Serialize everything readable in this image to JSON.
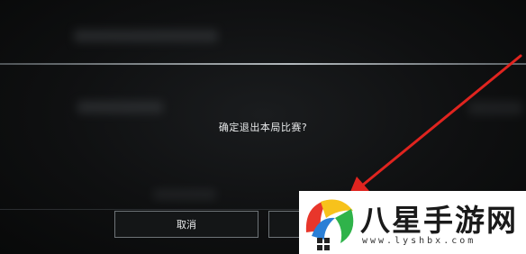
{
  "dialog": {
    "message": "确定退出本局比赛?",
    "cancel_label": "取消",
    "confirm_label": ""
  },
  "watermark": {
    "name": "八星手游网",
    "url": "www.lyshbx.com"
  },
  "colors": {
    "background": "#0b0c0d",
    "text": "#e7e9ea",
    "button_border": "#6e7478",
    "annotation_arrow": "#e0241f",
    "logo_red": "#e8362b",
    "logo_yellow": "#f7c21b",
    "logo_green": "#2fb34a",
    "logo_blue": "#2a7fd6"
  },
  "icons": {
    "annotation": "red-arrow-icon",
    "logo": "pinwheel-logo-icon"
  }
}
